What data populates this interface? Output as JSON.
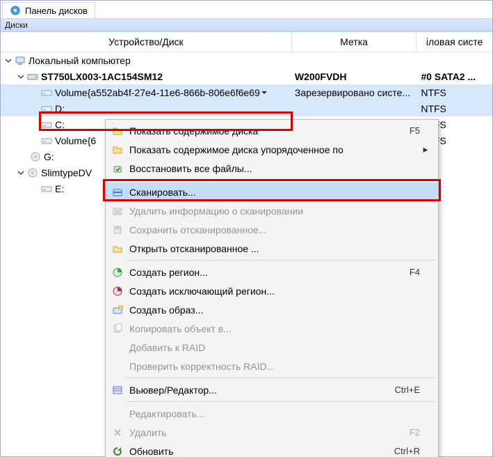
{
  "tab": {
    "title": "Панель дисков"
  },
  "section": {
    "title": "Диски"
  },
  "columns": {
    "device": "Устройство/Диск",
    "label": "Метка",
    "fs": "іловая систе"
  },
  "tree": {
    "root": "Локальный компьютер",
    "disk": {
      "name": "ST750LX003-1AC154SM12",
      "label": "W200FVDH",
      "fs": "#0 SATA2 ..."
    },
    "volGuid": {
      "name": "Volume{a552ab4f-27e4-11e6-866b-806e6f6e69",
      "label": "Зарезервировано систе...",
      "fs": "NTFS"
    },
    "d": {
      "name": "D:",
      "label": "",
      "fs": "NTFS"
    },
    "c": {
      "name": "C:",
      "label": "",
      "fs": "NTFS"
    },
    "vol2": {
      "name": "Volume{6",
      "label": "",
      "fs": "NTFS"
    },
    "g": {
      "name": "G:",
      "label": "",
      "fs": ""
    },
    "dvd": {
      "name": "SlimtypeDV",
      "label": "",
      "fs": ""
    },
    "e": {
      "name": "E:",
      "label": "",
      "fs": ""
    }
  },
  "ctx": {
    "showContents": "Показать содержимое диска",
    "showSorted": "Показать содержимое диска упорядоченное по",
    "recoverAll": "Восстановить все файлы...",
    "scan": "Сканировать...",
    "deleteScan": "Удалить информацию о сканировании",
    "saveScan": "Сохранить отсканированное...",
    "openScan": "Открыть отсканированное ...",
    "createRegion": "Создать регион...",
    "createExclRegion": "Создать исключающий регион...",
    "createImage": "Создать образ...",
    "copyObj": "Копировать объект в...",
    "addRaid": "Добавить к RAID",
    "checkRaid": "Проверить корректность RAID...",
    "viewerEditor": "Вьювер/Редактор...",
    "edit": "Редактировать...",
    "delete": "Удалить",
    "refresh": "Обновить",
    "shortcuts": {
      "showContents": "F5",
      "createRegion": "F4",
      "viewerEditor": "Ctrl+E",
      "delete": "F2",
      "refresh": "Ctrl+R"
    }
  }
}
